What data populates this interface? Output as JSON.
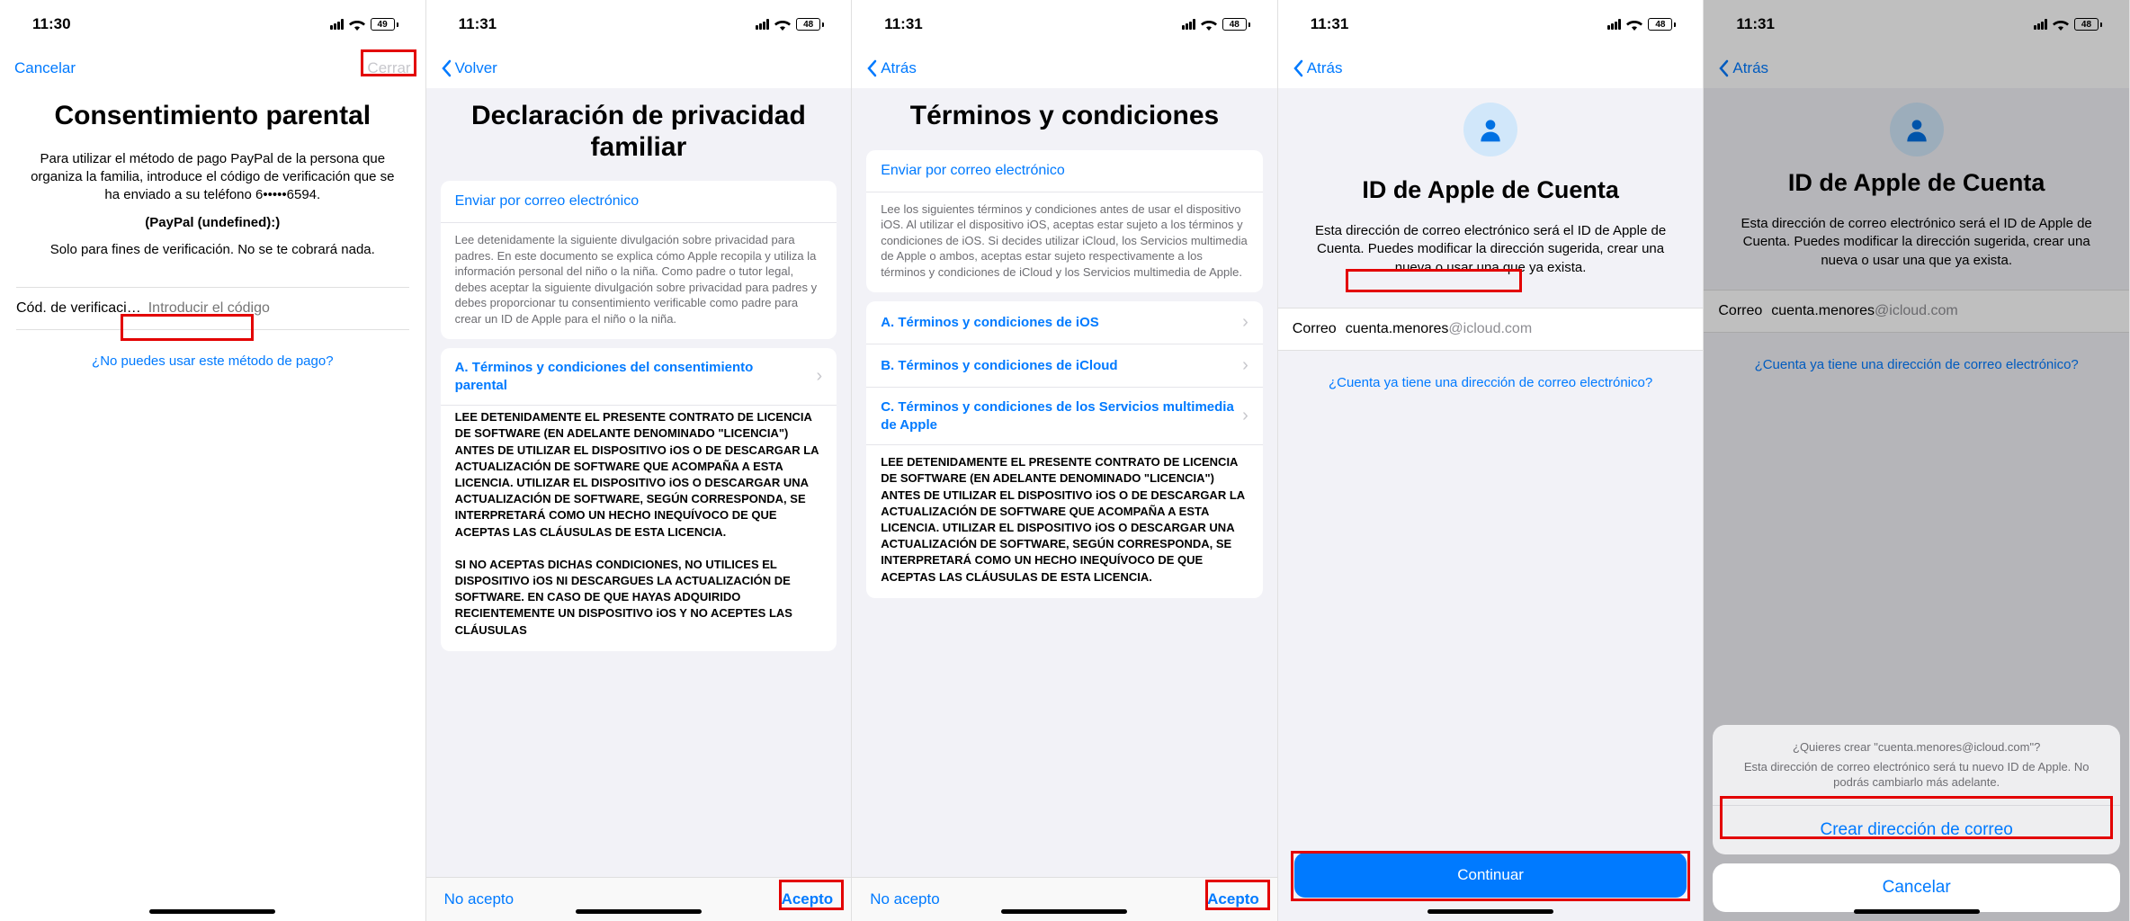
{
  "p1": {
    "time": "11:30",
    "battery": "49",
    "nav": {
      "cancel": "Cancelar",
      "close": "Cerrar"
    },
    "title": "Consentimiento parental",
    "body": "Para utilizar el método de pago PayPal de la persona que organiza la familia, introduce el código de verificación que se ha enviado a su teléfono 6•••••6594.",
    "paypal": "(PayPal (undefined):)",
    "note": "Solo para fines de verificación. No se te cobrará nada.",
    "field_label": "Cód. de verificaci…",
    "field_placeholder": "Introducir el código",
    "help": "¿No puedes usar este método de pago?"
  },
  "p2": {
    "time": "11:31",
    "battery": "48",
    "back": "Volver",
    "title": "Declaración de privacidad familiar",
    "email_link": "Enviar por correo electrónico",
    "intro": "Lee detenidamente la siguiente divulgación sobre privacidad para padres. En este documento se explica cómo Apple recopila y utiliza la información personal del niño o la niña. Como padre o tutor legal, debes aceptar la siguiente divulgación sobre privacidad para padres y debes proporcionar tu consentimiento verificable como padre para crear un ID de Apple para el niño o la niña.",
    "toc": [
      "A. Términos y condiciones del consentimiento parental"
    ],
    "contract1": "LEE DETENIDAMENTE EL PRESENTE CONTRATO DE LICENCIA DE SOFTWARE (EN ADELANTE DENOMINADO \"LICENCIA\") ANTES DE UTILIZAR EL DISPOSITIVO iOS O DE DESCARGAR LA ACTUALIZACIÓN DE SOFTWARE QUE ACOMPAÑA A ESTA LICENCIA. UTILIZAR EL DISPOSITIVO iOS O DESCARGAR UNA ACTUALIZACIÓN DE SOFTWARE, SEGÚN CORRESPONDA, SE INTERPRETARÁ COMO UN HECHO INEQUÍVOCO DE QUE ACEPTAS LAS CLÁUSULAS DE ESTA LICENCIA.",
    "contract2": "SI NO ACEPTAS DICHAS CONDICIONES, NO UTILICES EL DISPOSITIVO iOS NI DESCARGUES LA ACTUALIZACIÓN DE SOFTWARE. EN CASO DE QUE HAYAS ADQUIRIDO RECIENTEMENTE UN DISPOSITIVO iOS Y NO ACEPTES LAS CLÁUSULAS",
    "reject": "No acepto",
    "accept": "Acepto"
  },
  "p3": {
    "time": "11:31",
    "battery": "48",
    "back": "Atrás",
    "title": "Términos y condiciones",
    "email_link": "Enviar por correo electrónico",
    "intro": "Lee los siguientes términos y condiciones antes de usar el dispositivo iOS. Al utilizar el dispositivo iOS, aceptas estar sujeto a los términos y condiciones de iOS. Si decides utilizar iCloud, los Servicios multimedia de Apple o ambos, aceptas estar sujeto respectivamente a los términos y condiciones de iCloud y los Servicios multimedia de Apple.",
    "toc": [
      "A. Términos y condiciones de iOS",
      "B. Términos y condiciones de iCloud",
      "C. Términos y condiciones de los Servicios multimedia de Apple"
    ],
    "contract1": "LEE DETENIDAMENTE EL PRESENTE CONTRATO DE LICENCIA DE SOFTWARE (EN ADELANTE DENOMINADO \"LICENCIA\") ANTES DE UTILIZAR EL DISPOSITIVO iOS O DE DESCARGAR LA ACTUALIZACIÓN DE SOFTWARE QUE ACOMPAÑA A ESTA LICENCIA. UTILIZAR EL DISPOSITIVO iOS O DESCARGAR UNA ACTUALIZACIÓN DE SOFTWARE, SEGÚN CORRESPONDA, SE INTERPRETARÁ COMO UN HECHO INEQUÍVOCO DE QUE ACEPTAS LAS CLÁUSULAS DE ESTA LICENCIA.",
    "reject": "No acepto",
    "accept": "Acepto"
  },
  "p4": {
    "time": "11:31",
    "battery": "48",
    "back": "Atrás",
    "title": "ID de Apple de Cuenta",
    "body": "Esta dirección de correo electrónico será el ID de Apple de Cuenta. Puedes modificar la dirección sugerida, crear una nueva o usar una que ya exista.",
    "email_label": "Correo",
    "email_user": "cuenta.menores",
    "email_domain": "@icloud.com",
    "link": "¿Cuenta ya tiene una dirección de correo electrónico?",
    "continue": "Continuar"
  },
  "p5": {
    "time": "11:31",
    "battery": "48",
    "back": "Atrás",
    "title": "ID de Apple de Cuenta",
    "body": "Esta dirección de correo electrónico será el ID de Apple de Cuenta. Puedes modificar la dirección sugerida, crear una nueva o usar una que ya exista.",
    "email_label": "Correo",
    "email_user": "cuenta.menores",
    "email_domain": "@icloud.com",
    "link": "¿Cuenta ya tiene una dirección de correo electrónico?",
    "sheet_title": "¿Quieres crear \"cuenta.menores@icloud.com\"?",
    "sheet_body": "Esta dirección de correo electrónico será tu nuevo ID de Apple. No podrás cambiarlo más adelante.",
    "sheet_create": "Crear dirección de correo",
    "sheet_cancel": "Cancelar"
  }
}
